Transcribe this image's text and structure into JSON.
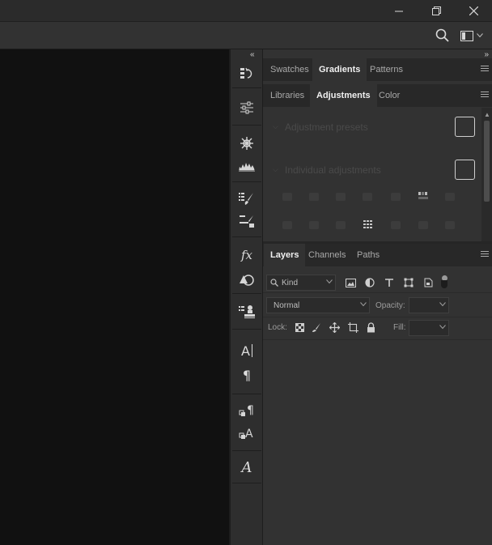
{
  "window": {
    "minimize_icon": "minimize-icon",
    "restore_icon": "restore-icon",
    "close_icon": "close-icon"
  },
  "optionsbar": {
    "search_icon": "search-icon",
    "workspace_icon": "workspace-icon"
  },
  "dock": {
    "collapse_glyph": "«",
    "groups": [
      {
        "items": [
          "history-icon"
        ]
      },
      {
        "items": [
          "properties-icon"
        ]
      },
      {
        "items": [
          "navigator-icon",
          "histogram-icon"
        ]
      },
      {
        "items": [
          "brush-settings-icon",
          "tool-presets-icon"
        ]
      },
      {
        "items": [
          "styles-icon",
          "shapes-icon"
        ]
      },
      {
        "items": [
          "clone-source-icon"
        ]
      },
      {
        "items": [
          "character-icon",
          "paragraph-icon"
        ]
      },
      {
        "items": [
          "paragraph-styles-icon",
          "character-styles-icon"
        ]
      },
      {
        "items": [
          "glyphs-icon"
        ]
      }
    ],
    "fx_label": "fx",
    "char_label": "A",
    "para_label": "¶",
    "glyph_label": "A"
  },
  "panels": {
    "collapse_glyph": "»",
    "row1_tabs": [
      {
        "label": "Swatches",
        "active": false
      },
      {
        "label": "Gradients",
        "active": true
      },
      {
        "label": "Patterns",
        "active": false
      }
    ],
    "row2_tabs": [
      {
        "label": "Libraries",
        "active": false
      },
      {
        "label": "Adjustments",
        "active": true
      },
      {
        "label": "Color",
        "active": false
      }
    ],
    "adjustments": {
      "presets_label": "Adjustment presets",
      "individual_label": "Individual adjustments"
    },
    "layers_tabs": [
      {
        "label": "Layers",
        "active": true
      },
      {
        "label": "Channels",
        "active": false
      },
      {
        "label": "Paths",
        "active": false
      }
    ],
    "layers": {
      "filter_value": "Kind",
      "blend_mode": "Normal",
      "opacity_label": "Opacity:",
      "opacity_value": "",
      "lock_label": "Lock:",
      "fill_label": "Fill:",
      "fill_value": ""
    }
  }
}
